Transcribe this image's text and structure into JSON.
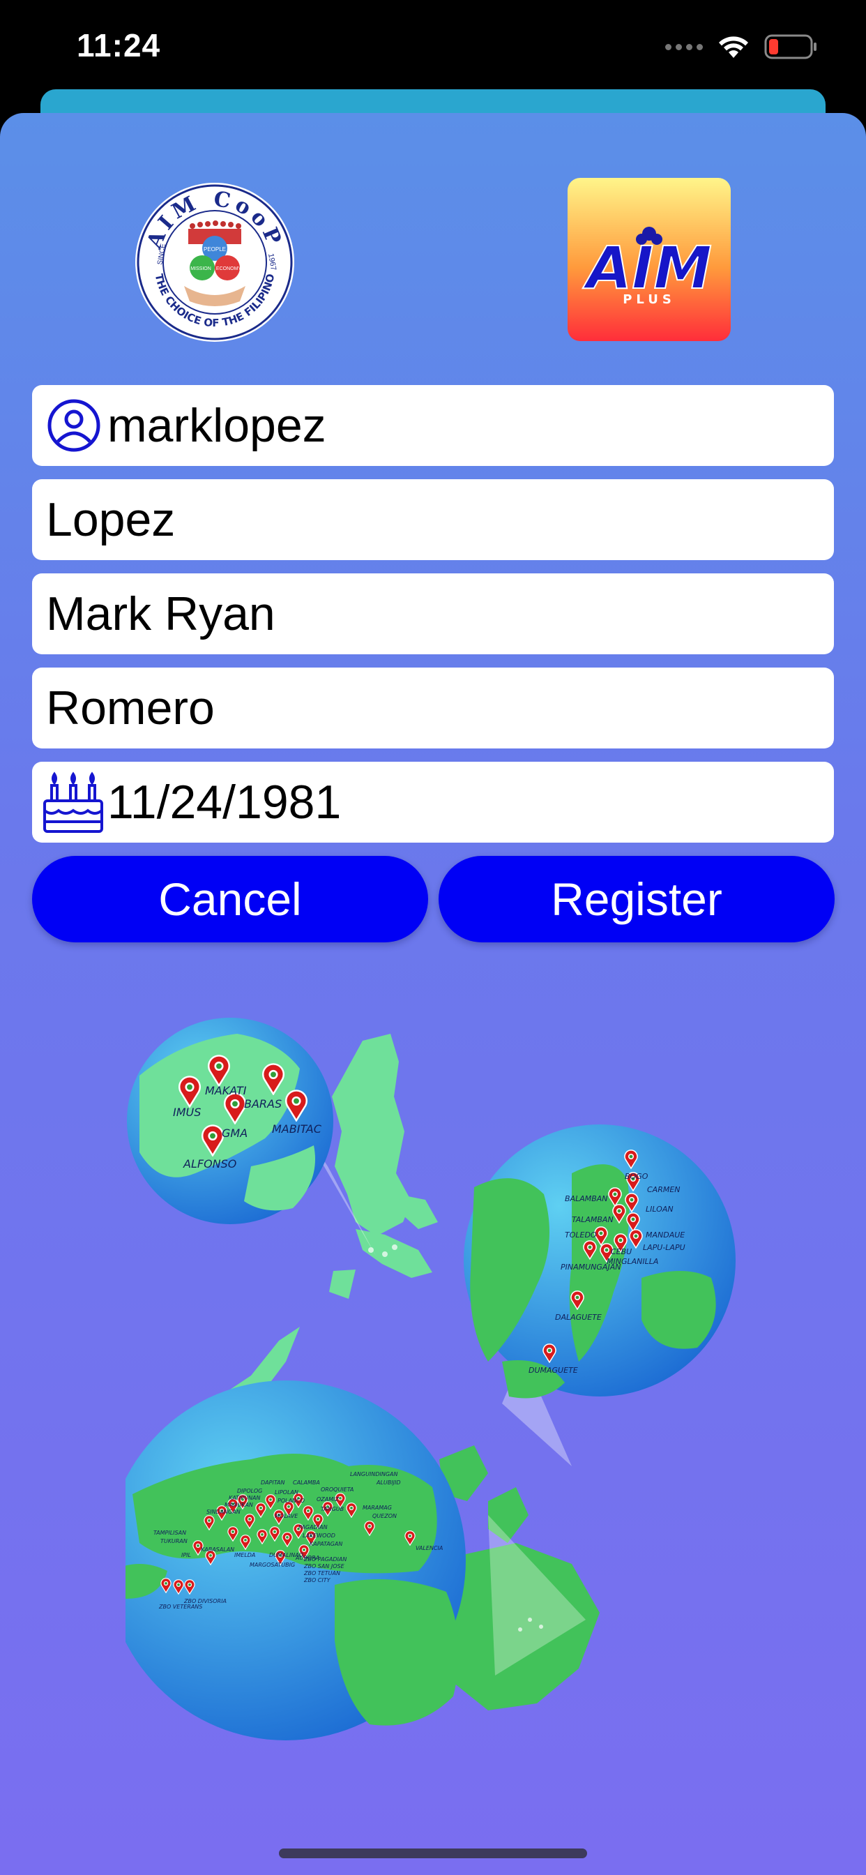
{
  "status_bar": {
    "time": "11:24"
  },
  "logos": {
    "left": {
      "name": "AIM CooP",
      "tagline": "THE CHOICE OF THE FILIPINO",
      "since": "SINCE",
      "year": "1967",
      "words": [
        "PEOPLE",
        "MISSION",
        "ECONOMY"
      ]
    },
    "right": {
      "name": "AIM",
      "sub": "PLUS"
    }
  },
  "form": {
    "username": "marklopez",
    "last_name": "Lopez",
    "first_name": "Mark Ryan",
    "middle_name": "Romero",
    "birthdate": "11/24/1981"
  },
  "buttons": {
    "cancel": "Cancel",
    "register": "Register"
  },
  "map": {
    "luzon_branches": [
      "MAKATI",
      "BARAS",
      "IMUS",
      "GMA",
      "MABITAC",
      "ALFONSO"
    ],
    "visayas_branches": [
      "BOGO",
      "CARMEN",
      "BALAMBAN",
      "LILOAN",
      "TALAMBAN",
      "TOLEDO",
      "MANDAUE",
      "CEBU",
      "LAPU-LAPU",
      "PINAMUNGAJAN",
      "MINGLANILLA",
      "DALAGUETE",
      "DUMAGUETE"
    ],
    "mindanao_branches": [
      "DAPITAN",
      "DIPOLOG",
      "KATIPUNAN",
      "MANUKAN",
      "SINDANGAN",
      "LIPOLAN",
      "CALAMBA",
      "OROQUIETA",
      "POLANCO",
      "OZAMIZ",
      "TANGUB",
      "MOLAVE",
      "TAMPILISAN",
      "TUKURAN",
      "IPIL",
      "KABASALAN",
      "IMELDA",
      "MARGOSATUBIG",
      "PAGADIAN",
      "LAKEWOOD",
      "DUMALINAO",
      "AURORA",
      "KAPATAGAN",
      "MARAMAG",
      "QUEZON",
      "VALENCIA",
      "LANGUINDINGAN",
      "ALUBIJID",
      "ZBO PAGADIAN",
      "ZBO SAN JOSE",
      "ZBO DIVISORIA",
      "ZBO VETERANS",
      "ZBO TETUAN",
      "ZBO CITY"
    ]
  },
  "colors": {
    "button_bg": "#0000f5",
    "button_text": "#ffffff",
    "sheet_top": "#5b8fe8",
    "sheet_bottom": "#7a6ef0",
    "back_card": "#2aa6cf"
  },
  "icons": {
    "username": "user-circle-icon",
    "birthdate": "birthday-cake-icon",
    "wifi": "wifi-icon",
    "battery": "battery-low-icon"
  }
}
